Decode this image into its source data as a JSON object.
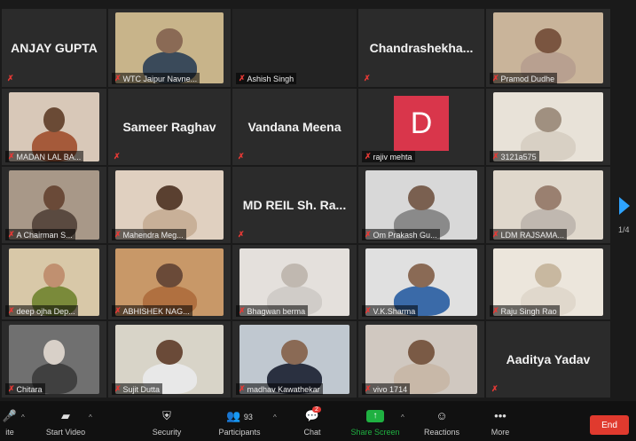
{
  "participants": [
    {
      "label": "ANJAY GUPTA",
      "type": "name"
    },
    {
      "label": "WTC Jaipur Navne...",
      "type": "video",
      "color": "#3a4a5a",
      "skin": "#8a6a55",
      "bg": "#c8b48a"
    },
    {
      "label": "Ashish Singh",
      "type": "blank"
    },
    {
      "label": "Chandrashekha...",
      "type": "name"
    },
    {
      "label": "Pramod Dudhe",
      "type": "video",
      "color": "#b8a090",
      "skin": "#7a5540",
      "bg": "#c9b49a"
    },
    {
      "label": "MADAN LAL BA...",
      "type": "video",
      "color": "#a55a3a",
      "skin": "#6a4a35",
      "bg": "#d8c8b8"
    },
    {
      "label": "Sameer Raghav",
      "type": "name"
    },
    {
      "label": "Vandana Meena",
      "type": "name"
    },
    {
      "label": "rajiv mehta",
      "type": "avatar",
      "initial": "D"
    },
    {
      "label": "3121a575",
      "type": "video",
      "color": "#d8d0c4",
      "skin": "#a09080",
      "bg": "#e8e2d8"
    },
    {
      "label": "A Chairman S...",
      "type": "video",
      "color": "#5a4a40",
      "skin": "#6a4a38",
      "bg": "#a89888"
    },
    {
      "label": "Mahendra Meg...",
      "type": "video",
      "color": "#c8b098",
      "skin": "#5a4030",
      "bg": "#e0d0c0"
    },
    {
      "label": "MD REIL Sh. Ra...",
      "type": "name"
    },
    {
      "label": "Om Prakash Gu...",
      "type": "video",
      "color": "#8a8a8a",
      "skin": "#7a6050",
      "bg": "#d8d8d8"
    },
    {
      "label": "LDM RAJSAMA...",
      "type": "video",
      "color": "#c0b8b0",
      "skin": "#9a8070",
      "bg": "#e0d8cc"
    },
    {
      "label": "deep ojha Dep...",
      "type": "video",
      "color": "#7a8a3a",
      "skin": "#c09070",
      "bg": "#d8c8a8"
    },
    {
      "label": "ABHISHEK NAG...",
      "type": "video",
      "color": "#b07040",
      "skin": "#6a4a38",
      "bg": "#c89868"
    },
    {
      "label": "Bhagwan berma",
      "type": "video",
      "color": "#d0ccc8",
      "skin": "#c0b8b0",
      "bg": "#e4e0dc"
    },
    {
      "label": "V.K.Sharma",
      "type": "video",
      "color": "#3a6aa8",
      "skin": "#8a6a55",
      "bg": "#e0e0e0"
    },
    {
      "label": "Raju Singh Rao",
      "type": "video",
      "color": "#e0d8cc",
      "skin": "#c8b8a0",
      "bg": "#ece6dc"
    },
    {
      "label": "Chitara",
      "type": "video",
      "color": "#404040",
      "skin": "#d8d0c8",
      "bg": "#707070"
    },
    {
      "label": "Sujit Dutta",
      "type": "video",
      "color": "#e8e8e8",
      "skin": "#6a4a38",
      "bg": "#d8d4c8"
    },
    {
      "label": "madhav Kawathekar",
      "type": "video",
      "color": "#2a3040",
      "skin": "#8a6a55",
      "bg": "#c0c8d0"
    },
    {
      "label": "vivo 1714",
      "type": "video",
      "color": "#c8b8a8",
      "skin": "#7a5a45",
      "bg": "#d0c8c0"
    },
    {
      "label": "Aaditya Yadav",
      "type": "name"
    }
  ],
  "pager": {
    "indicator": "1/4"
  },
  "toolbar": {
    "audio_label": "ite",
    "video_label": "Start Video",
    "security_label": "Security",
    "participants_label": "Participants",
    "participants_count": "93",
    "chat_label": "Chat",
    "chat_badge": "2",
    "share_label": "Share Screen",
    "reactions_label": "Reactions",
    "more_label": "More",
    "end_label": "End"
  },
  "colors": {
    "accent": "#2ea3ff",
    "end": "#e03a2e",
    "mute": "#e53935",
    "share": "#1fb141"
  }
}
